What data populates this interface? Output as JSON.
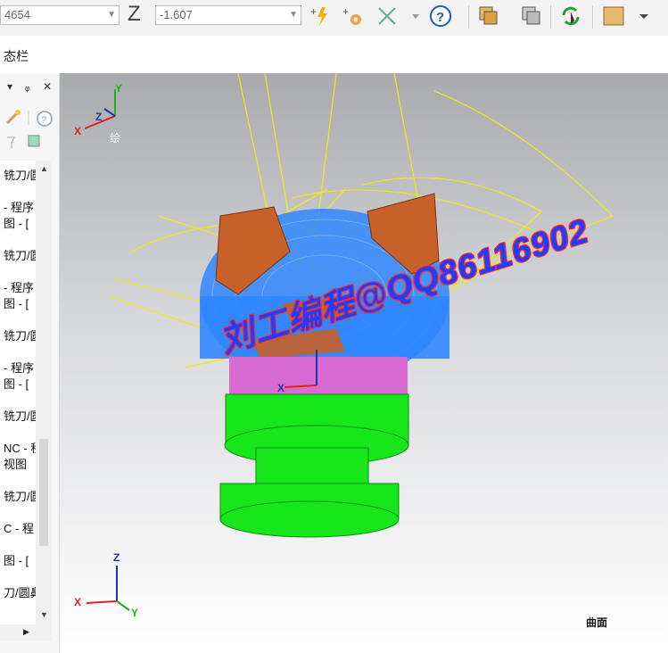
{
  "toolbar": {
    "field1_value": "4654",
    "z_label": "Z",
    "z_value": "-1.607"
  },
  "statusbar": {
    "label": "态栏"
  },
  "panel": {
    "autohide_label": "ᵩ",
    "close_label": "✕",
    "tree_items": [
      "铣刀/圆",
      "- 程序",
      "图 - [",
      "铣刀/圆",
      "- 程序",
      "图 - [",
      "铣刀/圆",
      "- 程序",
      "图 - [",
      "铣刀/圆",
      "NC - 程",
      "视图",
      "铣刀/圆",
      "C - 程",
      "图 - [",
      "刀/圆鼻"
    ]
  },
  "viewport": {
    "triad_top": {
      "x": "X",
      "y": "Y",
      "z": "Z",
      "extra": "绘"
    },
    "triad_mid": {
      "x": "X"
    },
    "triad_bottom": {
      "x": "X",
      "y": "Y",
      "z": "Z"
    },
    "surface_label": "曲面",
    "watermark": "刘工编程@QQ86116902"
  },
  "colors": {
    "yellow_path": "#f0e61e",
    "blue_surface": "#2f86ff",
    "orange_ears": "#c8602a",
    "magenta_band": "#d86ad4",
    "green_base": "#17e61b"
  }
}
